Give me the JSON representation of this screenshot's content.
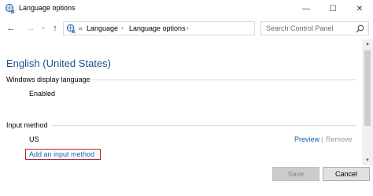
{
  "window": {
    "title": "Language options",
    "minimize_glyph": "—",
    "maximize_glyph": "☐",
    "close_glyph": "✕"
  },
  "nav": {
    "back_glyph": "←",
    "forward_glyph": "→",
    "recent_glyph": "▾",
    "up_glyph": "↑"
  },
  "address": {
    "chevrons": "«",
    "breadcrumbs": [
      "Language",
      "Language options"
    ],
    "separator": "›",
    "dropdown_glyph": "▾",
    "refresh_glyph": "↻"
  },
  "search": {
    "placeholder": "Search Control Panel"
  },
  "content": {
    "heading": "English (United States)",
    "display_language_label": "Windows display language",
    "display_language_value": "Enabled",
    "input_method_label": "Input method",
    "input_method_value": "US",
    "preview_link": "Preview",
    "link_separator": "|",
    "remove_link": "Remove",
    "add_input_method": "Add an input method"
  },
  "scrollbar": {
    "up_glyph": "▲",
    "down_glyph": "▼"
  },
  "buttons": {
    "save": "Save",
    "cancel": "Cancel"
  },
  "colors": {
    "heading": "#1e4e8c",
    "link": "#1a5fb4",
    "focus_border": "#b2252a",
    "icon_blue": "#2f6db5"
  },
  "icons": {
    "app": "language-globe-icon",
    "search": "magnifier-icon"
  }
}
